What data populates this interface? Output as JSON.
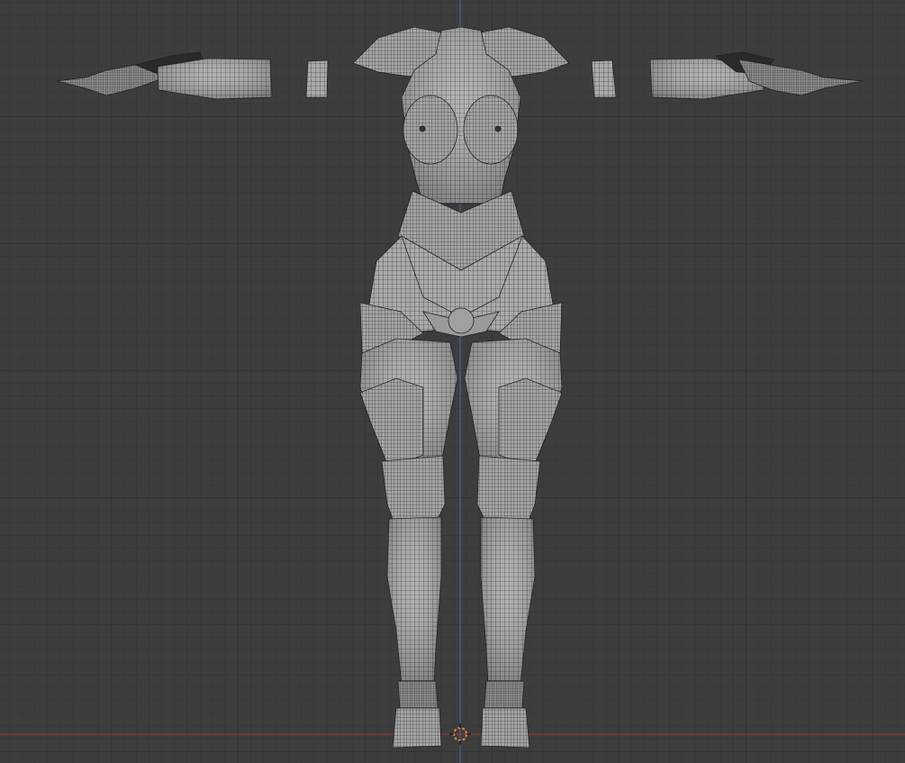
{
  "viewport": {
    "view": "front-orthographic",
    "shading": "solid-wireframe",
    "object": "female-armor-mesh",
    "pose": "T-pose",
    "colors": {
      "background": "#3d3d3d",
      "grid_major": "#343434",
      "grid_minor": "#383838",
      "x_axis": "#c0392b",
      "z_axis": "#3a6fb0",
      "mesh_fill": "#a9a9a9",
      "wire": "#2a2a2a",
      "cursor_ring": "#e08a3a"
    }
  }
}
